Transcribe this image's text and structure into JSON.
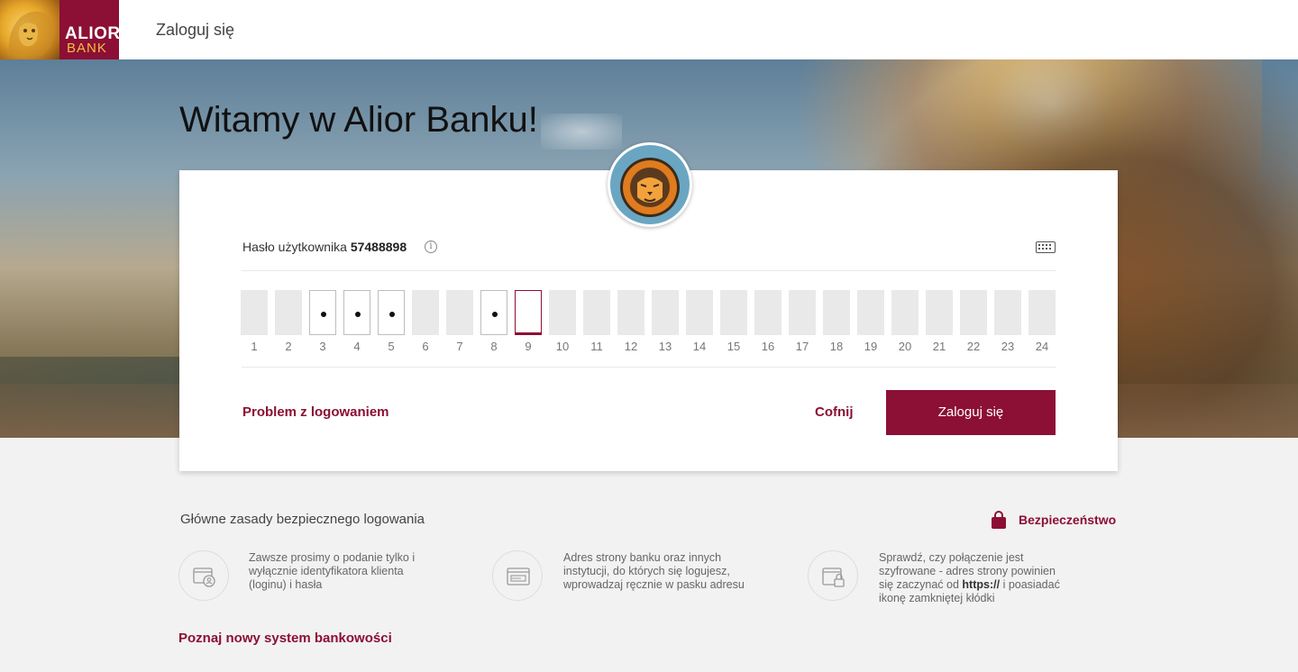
{
  "header": {
    "logo_line1": "ALIOR",
    "logo_line2": "BANK",
    "login_title": "Zaloguj się"
  },
  "hero": {
    "welcome": "Witamy w Alior Banku!"
  },
  "login": {
    "password_label": "Hasło użytkownika",
    "user_id": "57488898",
    "info_glyph": "i",
    "positions": [
      "1",
      "2",
      "3",
      "4",
      "5",
      "6",
      "7",
      "8",
      "9",
      "10",
      "11",
      "12",
      "13",
      "14",
      "15",
      "16",
      "17",
      "18",
      "19",
      "20",
      "21",
      "22",
      "23",
      "24"
    ],
    "problem_link": "Problem z logowaniem",
    "back_link": "Cofnij",
    "login_button": "Zaloguj się"
  },
  "security": {
    "rules_title": "Główne zasady bezpiecznego logowania",
    "security_link": "Bezpieczeństwo",
    "tips": [
      {
        "icon": "id-card-icon",
        "text": "Zawsze prosimy o podanie tylko i wyłącznie identyfikatora klienta (loginu) i hasła"
      },
      {
        "icon": "address-bar-icon",
        "text": "Adres strony banku oraz innych instytucji, do których się logujesz, wprowadzaj ręcznie w pasku adresu"
      },
      {
        "icon": "secure-page-icon",
        "text_before": "Sprawdź, czy połączenie jest szyfrowane - adres strony powinien się zaczynać od",
        "https": "https://",
        "text_after": " i poasiadać ikonę zamkniętej kłódki"
      }
    ],
    "new_system_link": "Poznaj nowy system bankowości"
  },
  "colors": {
    "brand": "#8c0f35",
    "box_inactive": "#e9e9e9"
  }
}
